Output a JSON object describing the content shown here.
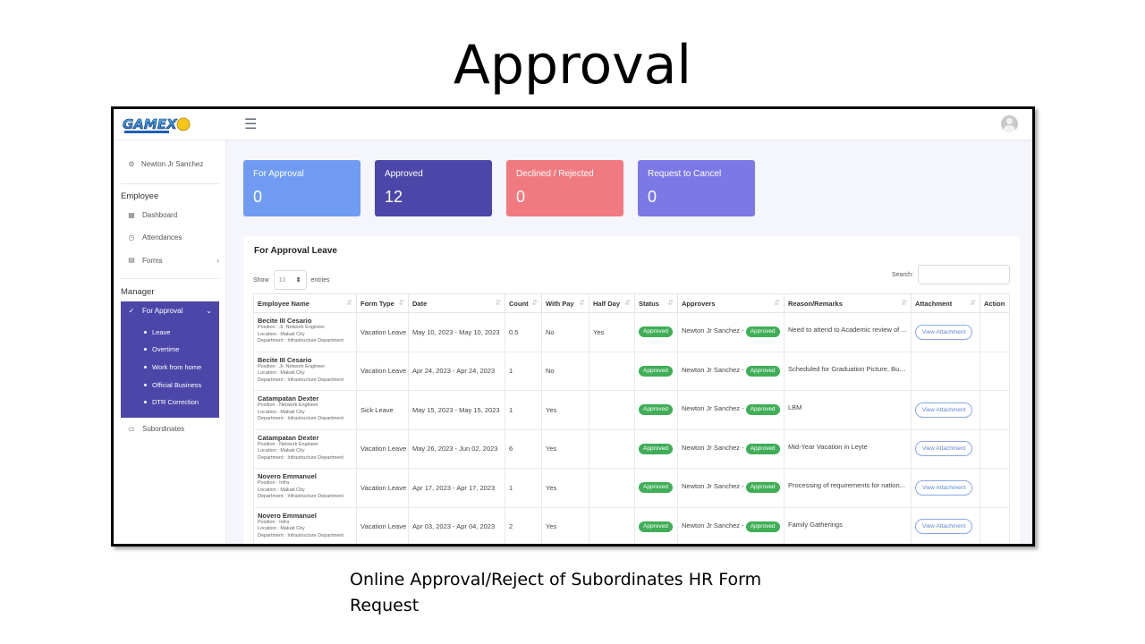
{
  "slide": {
    "title": "Approval",
    "caption": "Online Approval/Reject of Subordinates HR Form Request"
  },
  "app": {
    "logo_text": "GAMEX",
    "menu_icon": "hamburger-icon",
    "avatar_icon": "user-avatar-icon"
  },
  "sidebar": {
    "user_name": "Newton Jr Sanchez",
    "sections": {
      "employee": "Employee",
      "manager": "Manager"
    },
    "employee_items": [
      {
        "label": "Dashboard",
        "icon": "grid-icon"
      },
      {
        "label": "Attendances",
        "icon": "clock-icon"
      },
      {
        "label": "Forms",
        "icon": "form-icon"
      }
    ],
    "for_approval": {
      "label": "For Approval",
      "subitems": [
        "Leave",
        "Overtime",
        "Work from home",
        "Official Business",
        "DTR Correction"
      ]
    },
    "subordinates": "Subordinates"
  },
  "cards": [
    {
      "label": "For Approval",
      "value": "0",
      "color": "#6f9cf2"
    },
    {
      "label": "Approved",
      "value": "12",
      "color": "#4b46a8"
    },
    {
      "label": "Declined / Rejected",
      "value": "0",
      "color": "#f07a80"
    },
    {
      "label": "Request to Cancel",
      "value": "0",
      "color": "#7b79e6"
    }
  ],
  "table_panel": {
    "title": "For Approval Leave",
    "show_label": "Show",
    "entries_value": "10",
    "entries_label": "entries",
    "search_label": "Search:",
    "columns": [
      "Employee Name",
      "Form Type",
      "Date",
      "Count",
      "With Pay",
      "Half Day",
      "Status",
      "Approvers",
      "Reason/Remarks",
      "Attachment",
      "Action"
    ],
    "rows": [
      {
        "name": "Becite III Cesario",
        "position": "Position : Jr. Network Engineer",
        "location": "Location : Makati City",
        "department": "Department : Infrastructure Department",
        "form_type": "Vacation Leave",
        "date": "May 10, 2023 - May 10, 2023",
        "count": "0.5",
        "with_pay": "No",
        "half_day": "Yes",
        "status": "Approved",
        "approver": "Newton Jr Sanchez -",
        "approver_status": "Approved",
        "reason": "Need to attend to Academic review of ...",
        "attachment": "View Attachment"
      },
      {
        "name": "Becite III Cesario",
        "position": "Position : Jr. Network Engineer",
        "location": "Location : Makati City",
        "department": "Department : Infrastructure Department",
        "form_type": "Vacation Leave",
        "date": "Apr 24, 2023 - Apr 24, 2023",
        "count": "1",
        "with_pay": "No",
        "half_day": "",
        "status": "Approved",
        "approver": "Newton Jr Sanchez -",
        "approver_status": "Approved",
        "reason": "Scheduled for Graduation Picture, Bull...",
        "attachment": ""
      },
      {
        "name": "Catampatan Dexter",
        "position": "Position : Network Engineer",
        "location": "Location : Makati City",
        "department": "Department : Infrastructure Department",
        "form_type": "Sick Leave",
        "date": "May 15, 2023 - May 15, 2023",
        "count": "1",
        "with_pay": "Yes",
        "half_day": "",
        "status": "Approved",
        "approver": "Newton Jr Sanchez -",
        "approver_status": "Approved",
        "reason": "LBM",
        "attachment": "View Attachment"
      },
      {
        "name": "Catampatan Dexter",
        "position": "Position : Network Engineer",
        "location": "Location : Makati City",
        "department": "Department : Infrastructure Department",
        "form_type": "Vacation Leave",
        "date": "May 26, 2023 - Jun 02, 2023",
        "count": "6",
        "with_pay": "Yes",
        "half_day": "",
        "status": "Approved",
        "approver": "Newton Jr Sanchez -",
        "approver_status": "Approved",
        "reason": "Mid-Year Vacation in Leyte",
        "attachment": "View Attachment"
      },
      {
        "name": "Novero Emmanuel",
        "position": "Position : Infra",
        "location": "Location : Makati City",
        "department": "Department : Infrastructure Department",
        "form_type": "Vacation Leave",
        "date": "Apr 17, 2023 - Apr 17, 2023",
        "count": "1",
        "with_pay": "Yes",
        "half_day": "",
        "status": "Approved",
        "approver": "Newton Jr Sanchez -",
        "approver_status": "Approved",
        "reason": "Processing of requirements for nation...",
        "attachment": "View Attachment"
      },
      {
        "name": "Novero Emmanuel",
        "position": "Position : Infra",
        "location": "Location : Makati City",
        "department": "Department : Infrastructure Department",
        "form_type": "Vacation Leave",
        "date": "Apr 03, 2023 - Apr 04, 2023",
        "count": "2",
        "with_pay": "Yes",
        "half_day": "",
        "status": "Approved",
        "approver": "Newton Jr Sanchez -",
        "approver_status": "Approved",
        "reason": "Family Gatherings",
        "attachment": "View Attachment"
      }
    ]
  }
}
